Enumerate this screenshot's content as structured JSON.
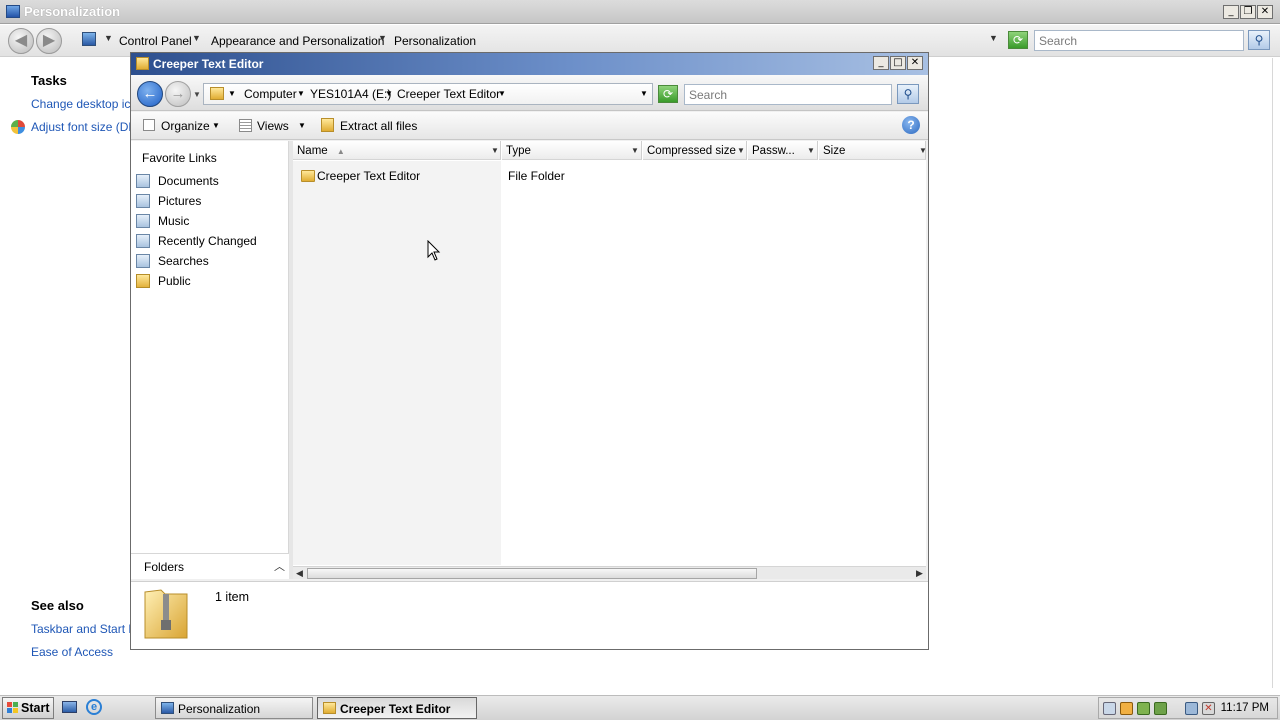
{
  "background_window": {
    "title": "Personalization",
    "breadcrumbs": [
      "Control Panel",
      "Appearance and Personalization",
      "Personalization"
    ],
    "search_placeholder": "Search",
    "tasks_heading": "Tasks",
    "task_links": [
      "Change desktop icons",
      "Adjust font size (DPI)"
    ],
    "see_also_heading": "See also",
    "see_also_links": [
      "Taskbar and Start Menu",
      "Ease of Access"
    ]
  },
  "explorer": {
    "title": "Creeper Text Editor",
    "breadcrumbs": [
      "Computer",
      "YES101A4 (E:)",
      "Creeper Text Editor"
    ],
    "search_placeholder": "Search",
    "toolbar": {
      "organize": "Organize",
      "views": "Views",
      "extract": "Extract all files"
    },
    "nav": {
      "favorites_title": "Favorite Links",
      "items": [
        "Documents",
        "Pictures",
        "Music",
        "Recently Changed",
        "Searches",
        "Public"
      ],
      "folders_label": "Folders"
    },
    "columns": [
      "Name",
      "Type",
      "Compressed size",
      "Passw...",
      "Size"
    ],
    "rows": [
      {
        "name": "Creeper Text Editor",
        "type": "File Folder"
      }
    ],
    "details": {
      "count": "1 item"
    }
  },
  "taskbar": {
    "start": "Start",
    "tasks": [
      "Personalization",
      "Creeper Text Editor"
    ],
    "clock": "11:17 PM"
  },
  "colors": {
    "link": "#1f57b6",
    "titlebar_active": "#2d4f8e"
  }
}
